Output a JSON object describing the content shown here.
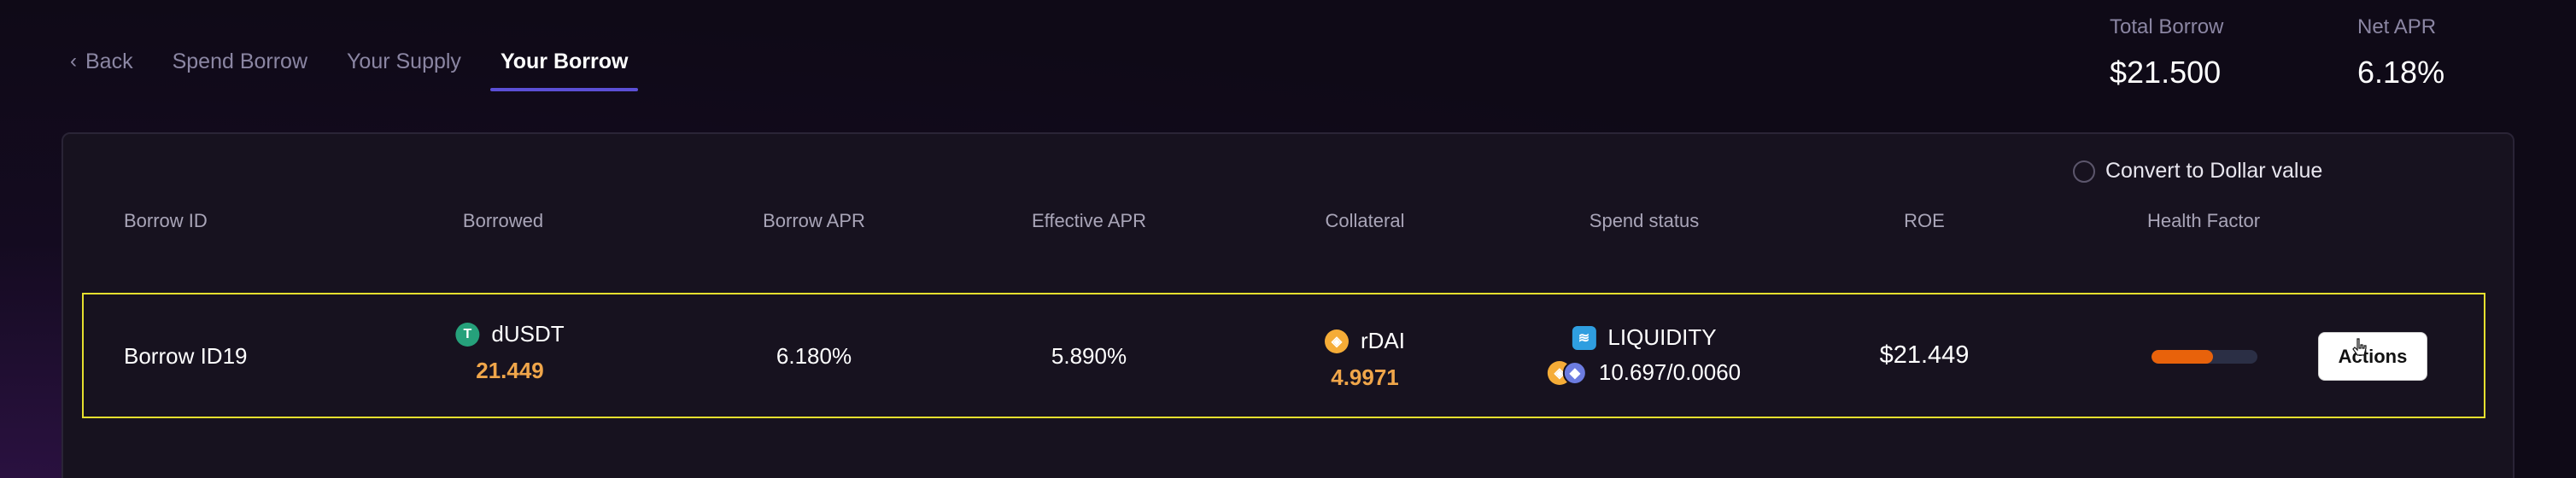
{
  "nav": {
    "back": "Back",
    "spend_borrow": "Spend Borrow",
    "your_supply": "Your Supply",
    "your_borrow": "Your Borrow"
  },
  "stats": {
    "total_borrow_label": "Total Borrow",
    "total_borrow_value": "$21.500",
    "net_apr_label": "Net APR",
    "net_apr_value": "6.18%"
  },
  "convert_label": "Convert to Dollar value",
  "table": {
    "headers": [
      "Borrow ID",
      "Borrowed",
      "Borrow APR",
      "Effective APR",
      "Collateral",
      "Spend status",
      "ROE",
      "Health Factor"
    ],
    "rows": [
      {
        "borrow_id": "Borrow ID19",
        "borrowed_token": "dUSDT",
        "borrowed_amount": "21.449",
        "borrow_apr": "6.180%",
        "effective_apr": "5.890%",
        "collateral_token": "rDAI",
        "collateral_amount": "4.9971",
        "spend_status": "LIQUIDITY",
        "spend_pair": "10.697/0.0060",
        "roe": "$21.449",
        "health_factor_fraction": 0.58,
        "actions_label": "Actions"
      }
    ]
  },
  "colors": {
    "accent": "#5b4fd6",
    "amount": "#f0a64a",
    "health_fill": "#e8620b",
    "row_highlight": "#e5df2e"
  },
  "icons": [
    "chevron-left-icon",
    "tether-icon",
    "dai-icon",
    "eth-icon",
    "liquidity-icon",
    "cursor-icon"
  ]
}
